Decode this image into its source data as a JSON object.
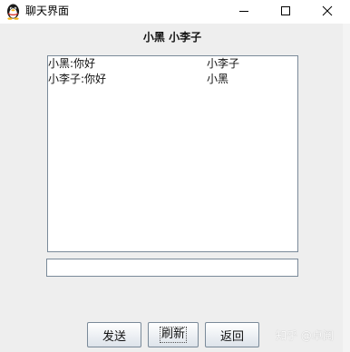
{
  "window": {
    "title": "聊天界面",
    "icon": "qq-penguin-icon",
    "controls": {
      "minimize": "minimize-icon",
      "maximize": "maximize-icon",
      "close": "close-icon"
    }
  },
  "chat": {
    "header": "小黑 小李子",
    "messages": [
      {
        "text": "小黑:你好",
        "recipient": "小李子"
      },
      {
        "text": "小李子:你好",
        "recipient": "小黑"
      }
    ]
  },
  "composer": {
    "value": "",
    "placeholder": ""
  },
  "buttons": {
    "send": "发送",
    "refresh": "刷新",
    "back": "返回"
  },
  "watermark": "知乎 @卓阅",
  "colors": {
    "background": "#eeeeee",
    "border": "#7a8a99",
    "button_top": "#ffffff",
    "button_bottom": "#dde3ea"
  }
}
